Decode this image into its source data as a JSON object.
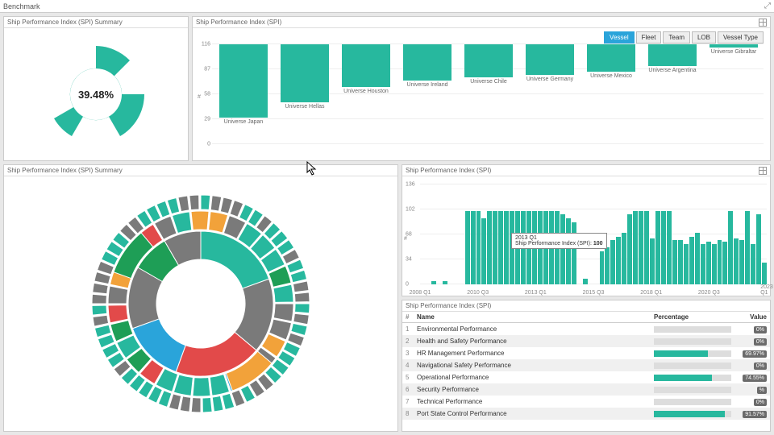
{
  "topbar": {
    "title": "Benchmark"
  },
  "panels": {
    "gauge": {
      "title": "Ship Performance Index (SPI) Summary",
      "center_label": "39.48%"
    },
    "vessel": {
      "title": "Ship Performance Index (SPI)",
      "pills": [
        "Vessel",
        "Fleet",
        "Team",
        "LOB",
        "Vessel Type"
      ],
      "active_pill": "Vessel",
      "ylabel": "#",
      "ymax": 116
    },
    "sunburst": {
      "title": "Ship Performance Index (SPI) Summary"
    },
    "quarterly": {
      "title": "Ship Performance Index (SPI)",
      "ylabel": "#",
      "ymax": 136,
      "tooltip_quarter": "2013 Q1",
      "tooltip_label": "Ship Performance Index (SPI):",
      "tooltip_value": "100"
    },
    "table": {
      "title": "Ship Performance Index (SPI)",
      "headers": {
        "num": "#",
        "name": "Name",
        "pct": "Percentage",
        "val": "Value"
      }
    }
  },
  "chart_data": [
    {
      "id": "gauge",
      "type": "gauge",
      "value": 39.48,
      "unit": "%",
      "title": "Ship Performance Index (SPI) Summary"
    },
    {
      "id": "vessel_bar",
      "type": "bar",
      "title": "Ship Performance Index (SPI)",
      "ylabel": "#",
      "ylim": [
        0,
        116
      ],
      "y_ticks": [
        0,
        29,
        58,
        87,
        116
      ],
      "categories": [
        "Universe Japan",
        "Universe Hellas",
        "Universe Houston",
        "Universe Ireland",
        "Universe Chile",
        "Universe Germany",
        "Universe Mexico",
        "Universe Argentina",
        "Universe Gibraltar"
      ],
      "values": [
        85,
        67,
        50,
        42,
        38,
        36,
        32,
        25,
        4
      ]
    },
    {
      "id": "quarterly_bar",
      "type": "bar",
      "title": "Ship Performance Index (SPI)",
      "ylabel": "#",
      "ylim": [
        0,
        136
      ],
      "y_ticks": [
        0,
        34,
        68,
        102,
        136
      ],
      "x_ticks": [
        "2008 Q1",
        "2010 Q3",
        "2013 Q1",
        "2015 Q3",
        "2018 Q1",
        "2020 Q3",
        "2023 Q1"
      ],
      "categories": [
        "2008 Q1",
        "2008 Q2",
        "2008 Q3",
        "2008 Q4",
        "2009 Q1",
        "2009 Q2",
        "2009 Q3",
        "2009 Q4",
        "2010 Q1",
        "2010 Q2",
        "2010 Q3",
        "2010 Q4",
        "2011 Q1",
        "2011 Q2",
        "2011 Q3",
        "2011 Q4",
        "2012 Q1",
        "2012 Q2",
        "2012 Q3",
        "2012 Q4",
        "2013 Q1",
        "2013 Q2",
        "2013 Q3",
        "2013 Q4",
        "2014 Q1",
        "2014 Q2",
        "2014 Q3",
        "2014 Q4",
        "2015 Q1",
        "2015 Q2",
        "2015 Q3",
        "2015 Q4",
        "2016 Q1",
        "2016 Q2",
        "2016 Q3",
        "2016 Q4",
        "2017 Q1",
        "2017 Q2",
        "2017 Q3",
        "2017 Q4",
        "2018 Q1",
        "2018 Q2",
        "2018 Q3",
        "2018 Q4",
        "2019 Q1",
        "2019 Q2",
        "2019 Q3",
        "2019 Q4",
        "2020 Q1",
        "2020 Q2",
        "2020 Q3",
        "2020 Q4",
        "2021 Q1",
        "2021 Q2",
        "2021 Q3",
        "2021 Q4",
        "2022 Q1",
        "2022 Q2",
        "2022 Q3",
        "2022 Q4",
        "2023 Q1",
        "2023 Q2"
      ],
      "values": [
        0,
        0,
        4,
        0,
        4,
        0,
        0,
        0,
        100,
        100,
        100,
        90,
        100,
        100,
        100,
        100,
        100,
        100,
        100,
        100,
        100,
        100,
        100,
        100,
        100,
        95,
        90,
        85,
        0,
        8,
        0,
        0,
        45,
        50,
        60,
        65,
        70,
        95,
        100,
        100,
        100,
        62,
        100,
        100,
        100,
        60,
        60,
        55,
        65,
        70,
        55,
        58,
        55,
        60,
        58,
        100,
        62,
        60,
        100,
        55,
        95,
        30
      ]
    },
    {
      "id": "perf_table",
      "type": "table",
      "title": "Ship Performance Index (SPI)",
      "columns": [
        "#",
        "Name",
        "Percentage",
        "Value"
      ],
      "rows": [
        {
          "num": 1,
          "name": "Environmental Performance",
          "pct": 0,
          "val": "0%"
        },
        {
          "num": 2,
          "name": "Health and Safety Performance",
          "pct": 0,
          "val": "0%"
        },
        {
          "num": 3,
          "name": "HR Management Performance",
          "pct": 69.97,
          "val": "69.97%"
        },
        {
          "num": 4,
          "name": "Navigational Safety Performance",
          "pct": 0,
          "val": "0%"
        },
        {
          "num": 5,
          "name": "Operational Performance",
          "pct": 74.55,
          "val": "74.55%"
        },
        {
          "num": 6,
          "name": "Security Performance",
          "pct": 0,
          "val": "%"
        },
        {
          "num": 7,
          "name": "Technical Performance",
          "pct": 0,
          "val": "0%"
        },
        {
          "num": 8,
          "name": "Port State Control Performance",
          "pct": 91.57,
          "val": "91.57%"
        }
      ]
    },
    {
      "id": "sunburst",
      "type": "sunburst",
      "title": "Ship Performance Index (SPI) Summary",
      "note": "multi-ring categorical breakdown; segment colors visible: teal, gray, red, green, orange, cyan",
      "rings": 3
    }
  ]
}
